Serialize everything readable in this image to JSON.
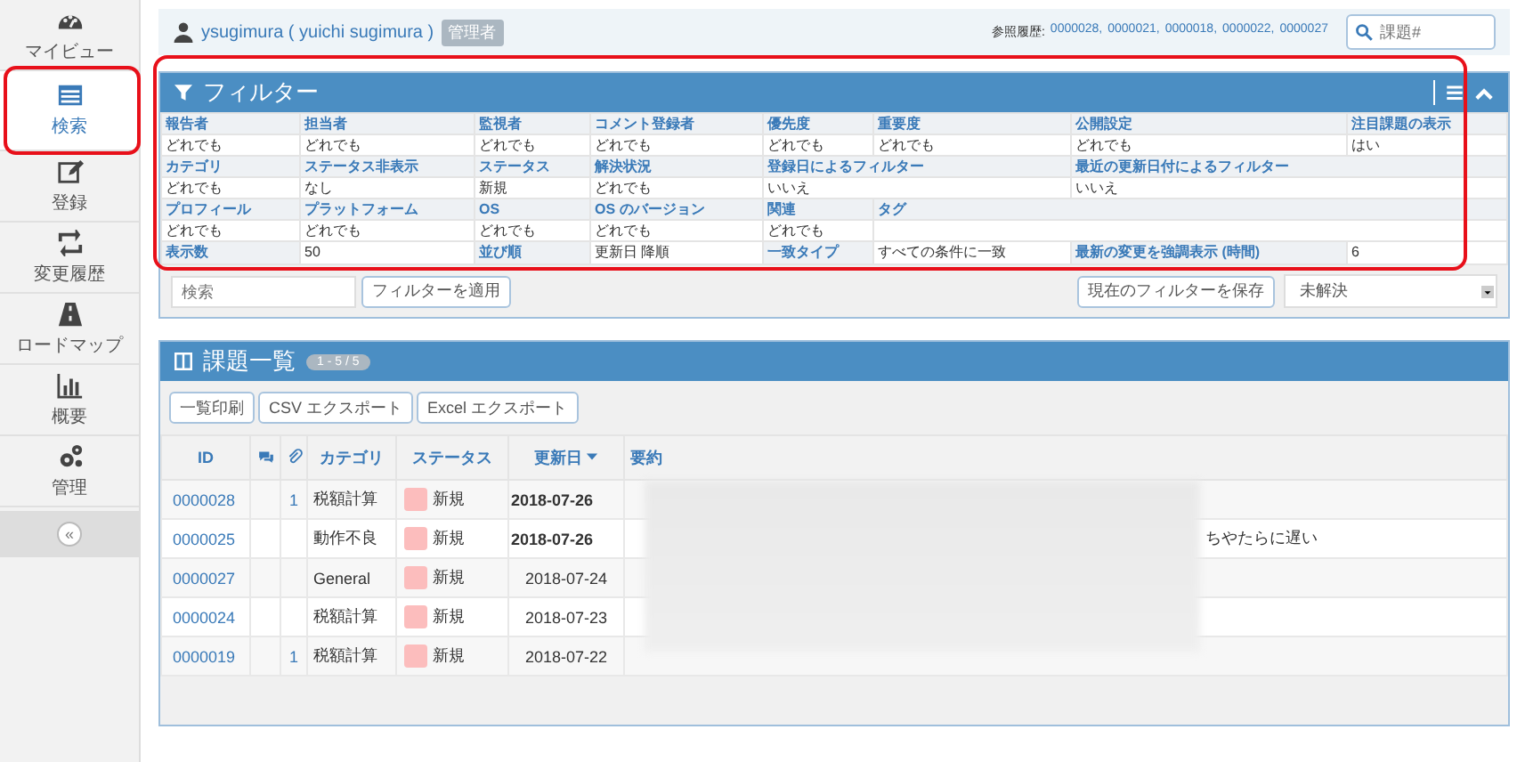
{
  "sidebar": {
    "items": [
      {
        "label": "マイビュー",
        "selected": false
      },
      {
        "label": "検索",
        "selected": true
      },
      {
        "label": "登録",
        "selected": false
      },
      {
        "label": "変更履歴",
        "selected": false
      },
      {
        "label": "ロードマップ",
        "selected": false
      },
      {
        "label": "概要",
        "selected": false
      },
      {
        "label": "管理",
        "selected": false
      }
    ],
    "collapse": "«"
  },
  "header": {
    "user": "ysugimura ( yuichi sugimura )",
    "role": "管理者",
    "recent_label": "参照履歴:",
    "recent": [
      "0000028,",
      "0000021,",
      "0000018,",
      "0000022,",
      "0000027"
    ],
    "search": {
      "placeholder": "課題#"
    }
  },
  "filter": {
    "title": "フィルター",
    "rows": [
      [
        {
          "label": "報告者",
          "value": "どれでも"
        },
        {
          "label": "担当者",
          "value": "どれでも"
        },
        {
          "label": "監視者",
          "value": "どれでも"
        },
        {
          "label": "コメント登録者",
          "value": "どれでも"
        },
        {
          "label": "優先度",
          "value": "どれでも"
        },
        {
          "label": "重要度",
          "value": "どれでも"
        },
        {
          "label": "公開設定",
          "value": "どれでも"
        },
        {
          "label": "注目課題の表示",
          "value": "はい"
        }
      ],
      [
        {
          "label": "カテゴリ",
          "value": "どれでも"
        },
        {
          "label": "ステータス非表示",
          "value": "なし"
        },
        {
          "label": "ステータス",
          "value": "新規"
        },
        {
          "label": "解決状況",
          "value": "どれでも"
        },
        {
          "label": "登録日によるフィルター",
          "value": "いいえ",
          "colspan": 2
        },
        {
          "label": "最近の更新日付によるフィルター",
          "value": "いいえ",
          "colspan": 2
        }
      ],
      [
        {
          "label": "プロフィール",
          "value": "どれでも"
        },
        {
          "label": "プラットフォーム",
          "value": "どれでも"
        },
        {
          "label": "OS",
          "value": "どれでも"
        },
        {
          "label": "OS のバージョン",
          "value": "どれでも"
        },
        {
          "label": "関連",
          "value": "どれでも"
        },
        {
          "label": "タグ",
          "colspan": 3
        }
      ]
    ],
    "settings": [
      {
        "label": "表示数",
        "value": "50"
      },
      {
        "label": "並び順",
        "value": "更新日 降順"
      },
      {
        "label": "一致タイプ",
        "value": "すべての条件に一致"
      },
      {
        "label": "最新の変更を強調表示 (時間)",
        "value": "6"
      }
    ],
    "search": {
      "placeholder": "検索"
    },
    "apply": "フィルターを適用",
    "save": "現在のフィルターを保存",
    "saved_filter": "未解決"
  },
  "issues": {
    "title": "課題一覧",
    "count": "1 - 5 / 5",
    "buttons": [
      "一覧印刷",
      "CSV エクスポート",
      "Excel エクスポート"
    ],
    "columns": [
      {
        "kind": "text",
        "label": "ID"
      },
      {
        "kind": "comments"
      },
      {
        "kind": "attachments"
      },
      {
        "kind": "text",
        "label": "カテゴリ"
      },
      {
        "kind": "text",
        "label": "ステータス"
      },
      {
        "kind": "sort",
        "label": "更新日"
      },
      {
        "kind": "text",
        "label": "要約"
      }
    ],
    "rows": [
      {
        "id": "0000028",
        "attachments": "1",
        "category": "税額計算",
        "status": "新規",
        "color": "#fcbdbd",
        "updated": "2018-07-26",
        "recent": true
      },
      {
        "id": "0000025",
        "category": "動作不良",
        "status": "新規",
        "color": "#fcbdbd",
        "updated": "2018-07-26",
        "recent": true,
        "summary": "ちやたらに遅い"
      },
      {
        "id": "0000027",
        "category": "General",
        "status": "新規",
        "color": "#fcbdbd",
        "updated": "2018-07-24",
        "recent": false
      },
      {
        "id": "0000024",
        "category": "税額計算",
        "status": "新規",
        "color": "#fcbdbd",
        "updated": "2018-07-23",
        "recent": false
      },
      {
        "id": "0000019",
        "attachments": "1",
        "category": "税額計算",
        "status": "新規",
        "color": "#fcbdbd",
        "updated": "2018-07-22",
        "recent": false
      }
    ]
  }
}
